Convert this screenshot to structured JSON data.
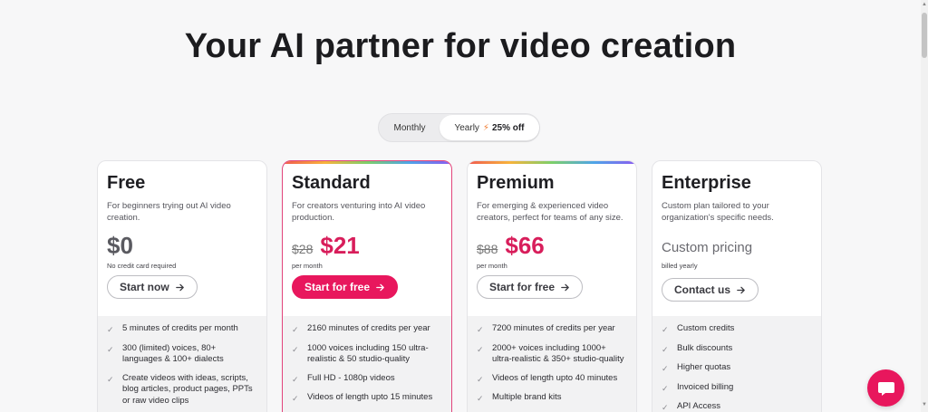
{
  "title": "Your AI partner for video creation",
  "billing_toggle": {
    "monthly_label": "Monthly",
    "yearly_label": "Yearly",
    "discount_label": "25% off",
    "selected": "Yearly"
  },
  "colors": {
    "accent": "#e8175d",
    "price_pink": "#d81e5b"
  },
  "plans": [
    {
      "name": "Free",
      "description": "For beginners trying out AI video creation.",
      "price": "$0",
      "price_note": "No credit card required",
      "cta": "Start now",
      "features": [
        "5 minutes of credits per month",
        "300 (limited) voices, 80+ languages & 100+ dialects",
        "Create videos with ideas, scripts, blog articles, product pages, PPTs or raw video clips"
      ]
    },
    {
      "name": "Standard",
      "description": "For creators venturing into AI video production.",
      "old_price": "$28",
      "price": "$21",
      "price_note": "per month",
      "cta": "Start for free",
      "features": [
        "2160 minutes of credits per year",
        "1000 voices including 150 ultra-realistic & 50 studio-quality",
        "Full HD - 1080p videos",
        "Videos of length upto 15 minutes"
      ]
    },
    {
      "name": "Premium",
      "description": "For emerging & experienced video creators, perfect for teams of any size.",
      "old_price": "$88",
      "price": "$66",
      "price_note": "per month",
      "cta": "Start for free",
      "features": [
        "7200 minutes of credits per year",
        "2000+ voices including 1000+ ultra-realistic & 350+ studio-quality",
        "Videos of length upto 40 minutes",
        "Multiple brand kits"
      ]
    },
    {
      "name": "Enterprise",
      "description": "Custom plan tailored to your organization's specific needs.",
      "price": "Custom pricing",
      "price_note": "billed yearly",
      "cta": "Contact us",
      "features": [
        "Custom credits",
        "Bulk discounts",
        "Higher quotas",
        "Invoiced billing",
        "API Access"
      ]
    }
  ],
  "icons": {
    "check": "check-icon",
    "arrow": "arrow-right-icon",
    "bolt": "lightning-icon",
    "chat": "chat-bubble-icon"
  }
}
